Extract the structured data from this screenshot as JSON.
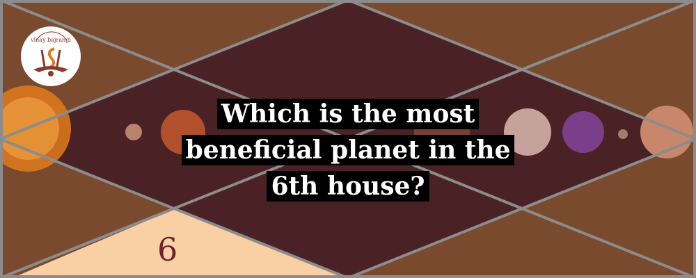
{
  "logo": {
    "text": "vinay bajrangi",
    "monogram": "VB"
  },
  "title_lines": [
    "Which is the most",
    "beneficial planet in the",
    "6th house?"
  ],
  "house_number": "6",
  "colors": {
    "outer": "#7a4a2e",
    "inner": "#4a2226",
    "highlight": "#f9cfa4",
    "lines": "#8c8c8c",
    "number": "#6e2230"
  }
}
